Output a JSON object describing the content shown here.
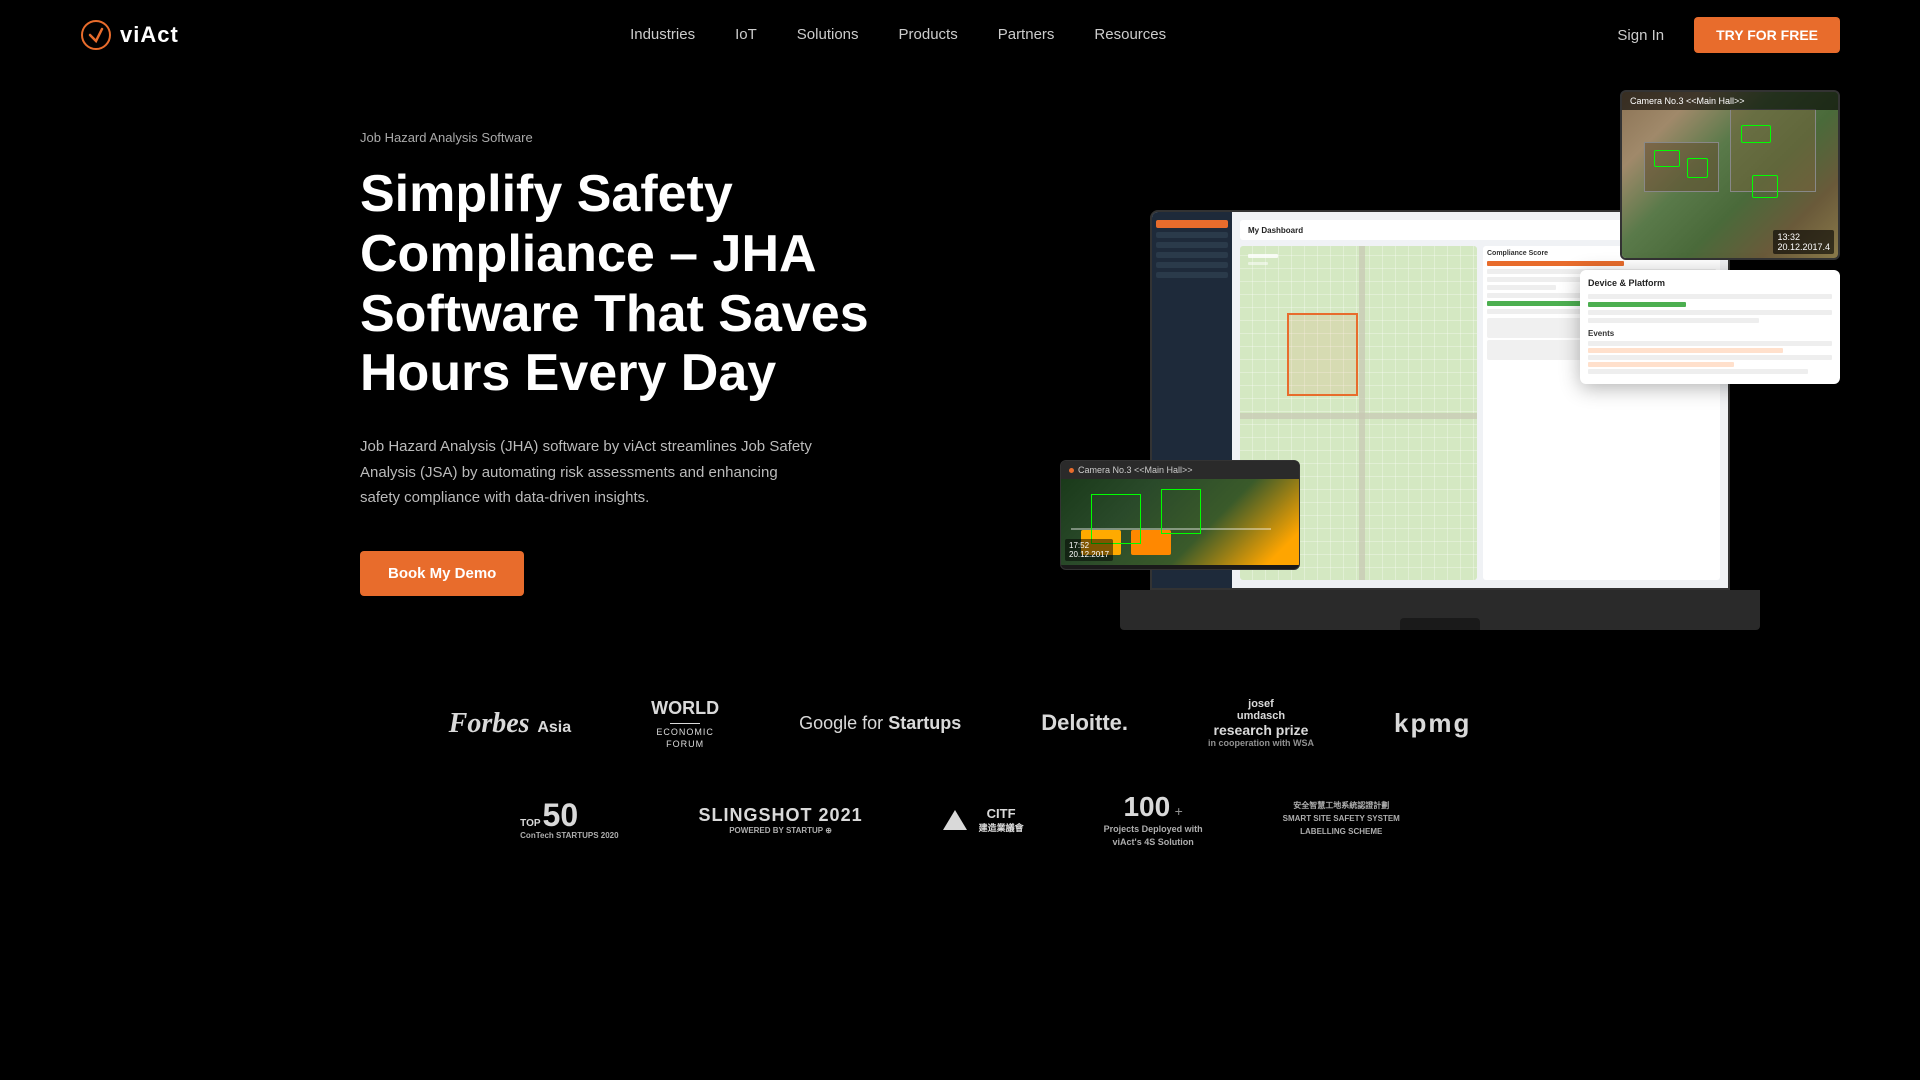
{
  "nav": {
    "logo_text": "viAct",
    "links": [
      {
        "label": "Industries",
        "id": "industries"
      },
      {
        "label": "IoT",
        "id": "iot"
      },
      {
        "label": "Solutions",
        "id": "solutions"
      },
      {
        "label": "Products",
        "id": "products"
      },
      {
        "label": "Partners",
        "id": "partners"
      },
      {
        "label": "Resources",
        "id": "resources"
      }
    ],
    "sign_in": "Sign In",
    "try_free": "TRY FOR FREE"
  },
  "hero": {
    "subtitle": "Job Hazard Analysis Software",
    "title": "Simplify Safety Compliance – JHA Software That Saves Hours Every Day",
    "description": "Job Hazard Analysis (JHA) software by viAct streamlines Job Safety Analysis (JSA) by automating risk assessments and enhancing safety compliance with data-driven insights.",
    "cta": "Book My Demo"
  },
  "camera": {
    "label": "Camera No.3 <<Main Hall>>",
    "time": "17:52",
    "date": "20.12.2017"
  },
  "aerial": {
    "label": "Camera No.3 <<Main Hall>>",
    "time": "13:32",
    "date": "20.12.2017.4"
  },
  "brands_row1": [
    {
      "id": "forbes",
      "text": "Forbes Asia"
    },
    {
      "id": "wef",
      "lines": [
        "WORLD",
        "ECONOMIC",
        "FORUM"
      ]
    },
    {
      "id": "google",
      "text": "Google for Startups"
    },
    {
      "id": "deloitte",
      "text": "Deloitte."
    },
    {
      "id": "josef",
      "lines": [
        "josef",
        "umdasch",
        "research prize"
      ]
    },
    {
      "id": "kpmg",
      "text": "kpmg"
    }
  ],
  "brands_row2": [
    {
      "id": "top50",
      "number": "50",
      "label": "ConTech STARTUPS 2020"
    },
    {
      "id": "slingshot",
      "text": "SLINGSHOT 2021",
      "sub": "POWERED BY STARTUP"
    },
    {
      "id": "citf",
      "text": "CITF 建造業議會"
    },
    {
      "id": "hundred",
      "number": "100+",
      "label1": "Projects Deployed with",
      "label2": "viAct's 4S Solution"
    },
    {
      "id": "4s",
      "text": "安全智慧工地系統認證計劃 SMART SITE SAFETY SYSTEM LABELLING SCHEME"
    }
  ]
}
